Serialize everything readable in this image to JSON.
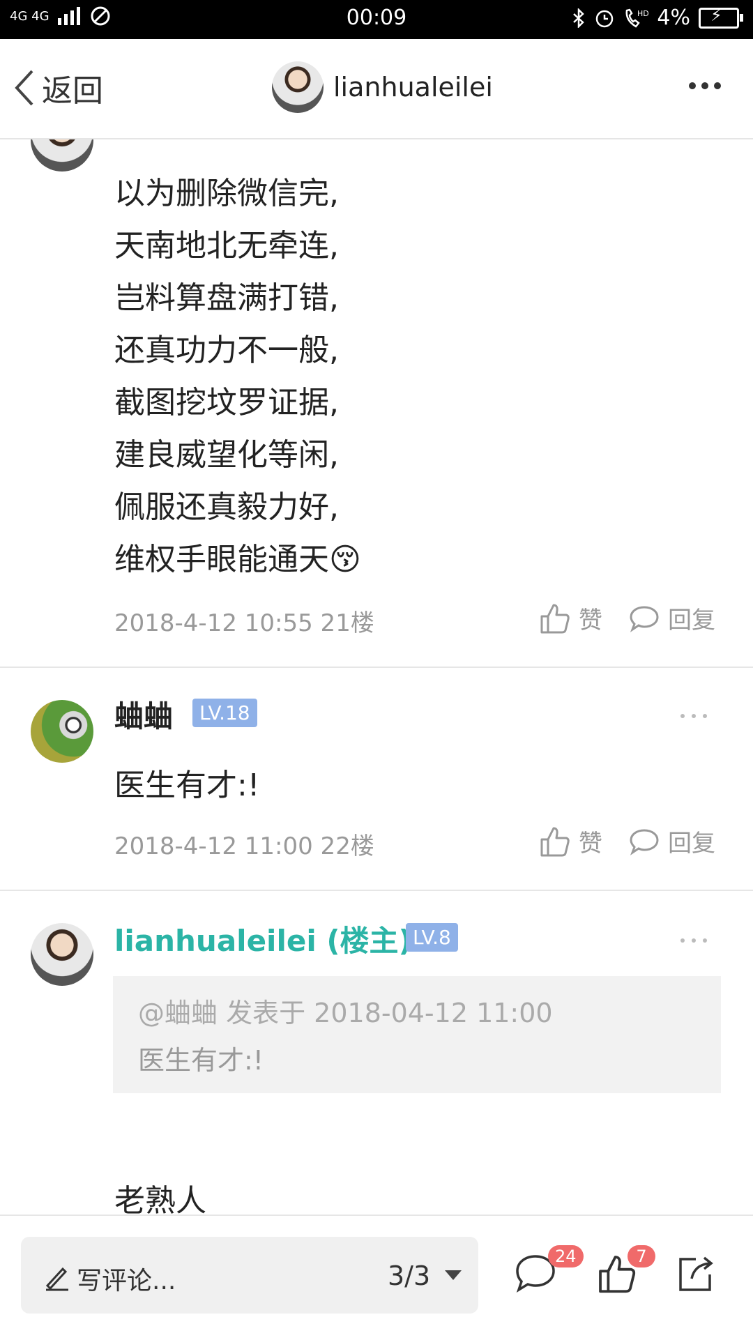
{
  "status_bar": {
    "network": "4G 4G",
    "time": "00:09",
    "battery": "4%"
  },
  "nav": {
    "back_label": "返回",
    "title": "lianhualeilei"
  },
  "post1": {
    "lines": [
      "以为删除微信完,",
      "天南地北无牵连,",
      "岂料算盘满打错,",
      "还真功力不一般,",
      "截图挖坟罗证据,",
      "建良威望化等闲,",
      "佩服还真毅力好,",
      "维权手眼能通天"
    ],
    "emoji": "😚",
    "meta": "2018-4-12 10:55  21楼",
    "like_label": "赞",
    "reply_label": "回复"
  },
  "post2": {
    "user": "蛐蛐",
    "level": "LV.18",
    "text": "医生有才:!",
    "meta": "2018-4-12 11:00  22楼",
    "like_label": "赞",
    "reply_label": "回复"
  },
  "post3": {
    "user": "lianhualeilei (楼主)",
    "level": "LV.8",
    "quote_header": "@蛐蛐 发表于 2018-04-12 11:00",
    "quote_text": "医生有才:!",
    "text": "老熟人"
  },
  "bottom": {
    "placeholder": "写评论...",
    "page": "3/3",
    "comment_count": "24",
    "like_count": "7"
  },
  "colors": {
    "accent": "#2bb4a6",
    "badge": "#8fb1e8",
    "count_badge": "#f06a6a"
  }
}
